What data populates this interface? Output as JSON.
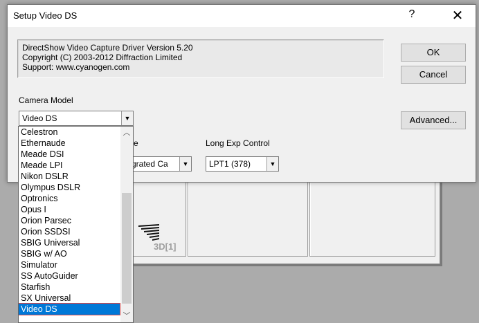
{
  "dialog": {
    "title": "Setup Video DS",
    "help_glyph": "?",
    "close_glyph": "✕"
  },
  "info": {
    "line1": "DirectShow Video Capture Driver Version 5.20",
    "line2": "Copyright (C) 2003-2012 Diffraction Limited",
    "line3": "Support: www.cyanogen.com"
  },
  "buttons": {
    "ok": "OK",
    "cancel": "Cancel",
    "advanced": "Advanced..."
  },
  "camera": {
    "label": "Camera Model",
    "value": "Video DS",
    "options": [
      "Celestron",
      "Ethernaude",
      "Meade DSI",
      "Meade LPI",
      "Nikon DSLR",
      "Olympus DSLR",
      "Optronics",
      "Opus I",
      "Orion Parsec",
      "Orion SSDSI",
      "SBIG Universal",
      "SBIG w/ AO",
      "Simulator",
      "SS AutoGuider",
      "Starfish",
      "SX Universal",
      "Video DS"
    ],
    "selected_index": 16
  },
  "grabber": {
    "label_partial": "ce",
    "value_partial": "grated Ca"
  },
  "long_exp": {
    "label": "Long Exp Control",
    "value": "LPT1 (378)"
  },
  "background_window": {
    "panel_label": "3D[1]"
  },
  "icons": {
    "dropdown_arrow": "chevron-down-icon",
    "scroll_up": "chevron-up-icon"
  }
}
